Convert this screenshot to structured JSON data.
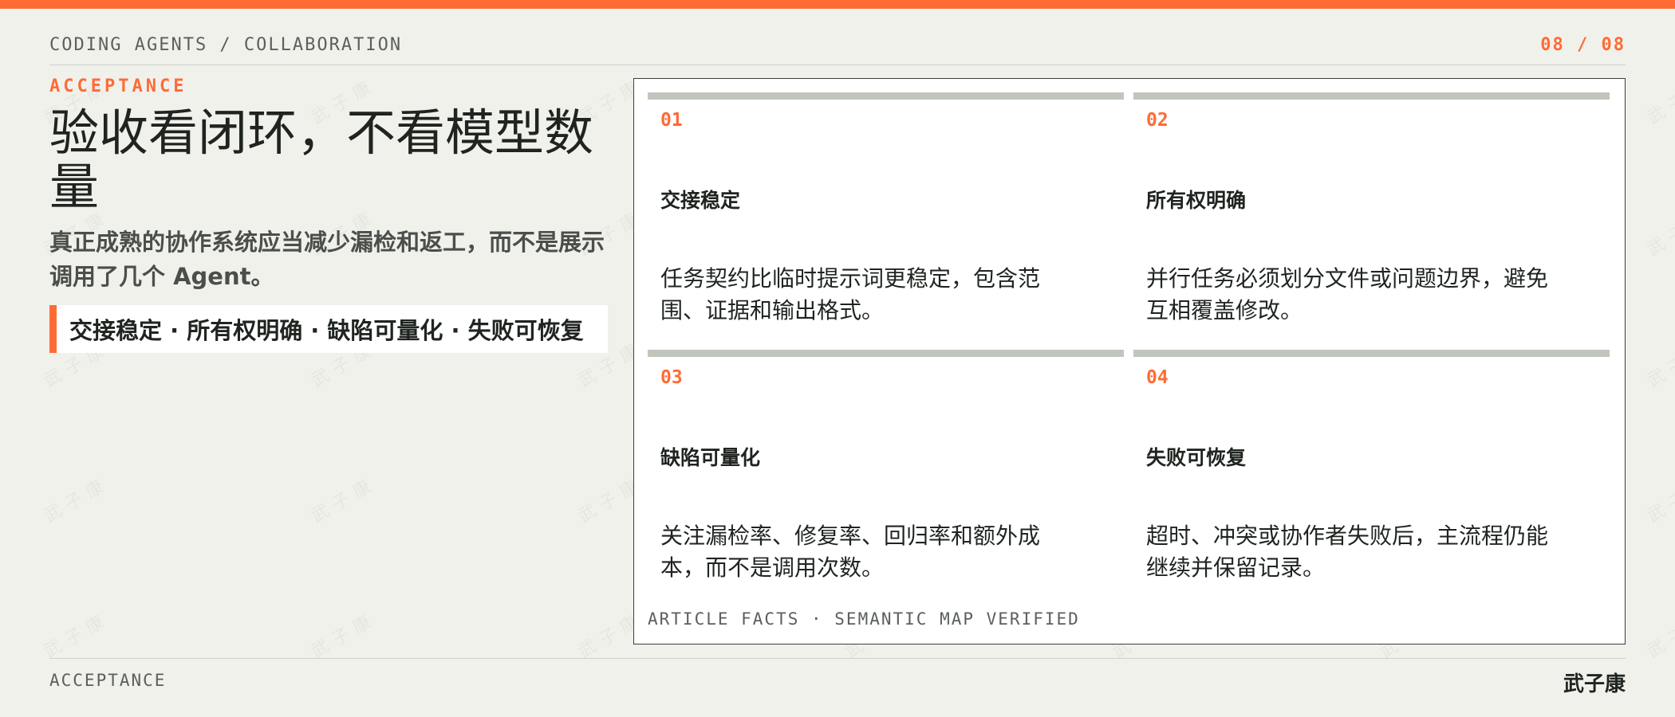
{
  "header": {
    "kicker": "CODING AGENTS / COLLABORATION",
    "page_number": "08 / 08"
  },
  "hero": {
    "eyebrow": "ACCEPTANCE",
    "title": "验收看闭环，不看模型数量",
    "subtitle": "真正成熟的协作系统应当减少漏检和返工，而不是展示调用了几个 Agent。",
    "callout": "交接稳定 · 所有权明确 · 缺陷可量化 · 失败可恢复"
  },
  "cards": [
    {
      "num": "01",
      "title": "交接稳定",
      "body": "任务契约比临时提示词更稳定，包含范围、证据和输出格式。"
    },
    {
      "num": "02",
      "title": "所有权明确",
      "body": "并行任务必须划分文件或问题边界，避免互相覆盖修改。"
    },
    {
      "num": "03",
      "title": "缺陷可量化",
      "body": "关注漏检率、修复率、回归率和额外成本，而不是调用次数。"
    },
    {
      "num": "04",
      "title": "失败可恢复",
      "body": "超时、冲突或协作者失败后，主流程仍能继续并保留记录。"
    }
  ],
  "panel": {
    "footnote": "ARTICLE FACTS · SEMANTIC MAP VERIFIED"
  },
  "footer": {
    "section": "ACCEPTANCE",
    "author": "武子康"
  },
  "watermark": "武子康",
  "colors": {
    "accent": "#ff6b35",
    "background": "#f1f1ec",
    "rule": "#c1c6bd"
  }
}
